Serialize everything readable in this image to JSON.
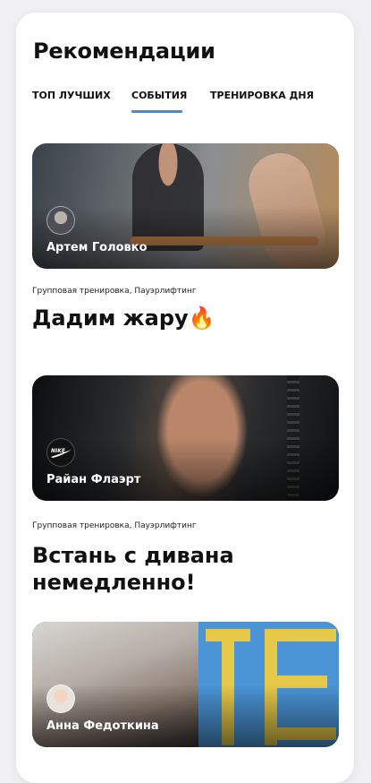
{
  "header": {
    "title": "Рекомендации"
  },
  "tabs": [
    {
      "label": "ТОП ЛУЧШИХ"
    },
    {
      "label": "СОБЫТИЯ",
      "active": true
    },
    {
      "label": "ТРЕНИРОВКА ДНЯ"
    }
  ],
  "colors": {
    "accent": "#3c8dde"
  },
  "feed": [
    {
      "author": "Артем Головко",
      "avatar": "person-avatar",
      "category": "Групповая тренировка, Пауэрлифтинг",
      "title": "Дадим жару🔥"
    },
    {
      "author": "Райан Флаэрт",
      "avatar": "nike-logo",
      "avatar_logo_text": "NIKE",
      "category": "Групповая тренировка, Пауэрлифтинг",
      "title": "Встань с дивана немедленно!"
    },
    {
      "author": "Анна Федоткина",
      "avatar": "person-avatar"
    }
  ]
}
